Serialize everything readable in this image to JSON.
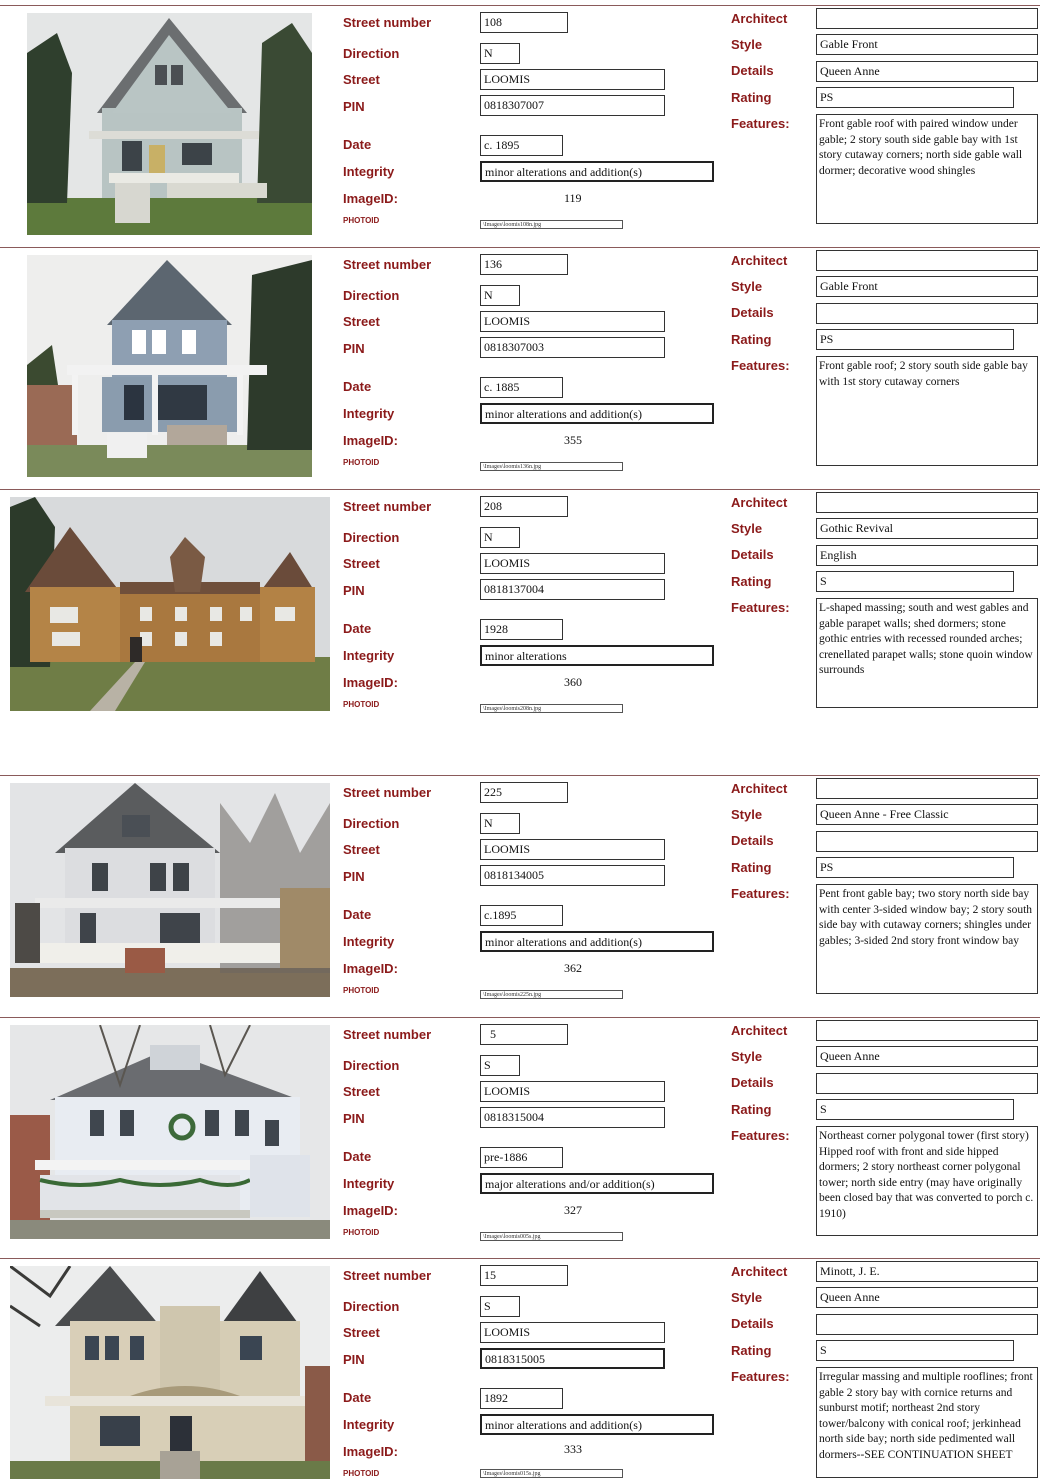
{
  "labels": {
    "street_number": "Street number",
    "direction": "Direction",
    "street": "Street",
    "pin": "PIN",
    "date": "Date",
    "integrity": "Integrity",
    "image_id": "ImageID:",
    "photo_id": "PHOTOID",
    "architect": "Architect",
    "style": "Style",
    "details": "Details",
    "rating": "Rating",
    "features": "Features:"
  },
  "colors": {
    "label": "#8b1a1a",
    "divider": "#8a5a5a"
  },
  "records": [
    {
      "street_number": "108",
      "direction": "N",
      "street": "LOOMIS",
      "pin": "0818307007",
      "date": "c. 1895",
      "integrity": "minor alterations and addition(s)",
      "image_id": "119",
      "photo_id": "\\Images\\loomis108n.jpg",
      "architect": "",
      "style": "Gable Front",
      "details": "Queen Anne",
      "rating": "PS",
      "features": "Front gable roof with paired window under gable; 2 story south side gable bay with 1st story cutaway corners; north side gable wall dormer; decorative wood shingles"
    },
    {
      "street_number": "136",
      "direction": "N",
      "street": "LOOMIS",
      "pin": "0818307003",
      "date": "c. 1885",
      "integrity": "minor alterations and addition(s)",
      "image_id": "355",
      "photo_id": "\\Images\\loomis136n.jpg",
      "architect": "",
      "style": "Gable Front",
      "details": "",
      "rating": "PS",
      "features": "Front gable roof; 2 story south side gable bay with 1st story cutaway corners"
    },
    {
      "street_number": "208",
      "direction": "N",
      "street": "LOOMIS",
      "pin": "0818137004",
      "date": "1928",
      "integrity": "minor alterations",
      "image_id": "360",
      "photo_id": "\\Images\\loomis208n.jpg",
      "architect": "",
      "style": "Gothic Revival",
      "details": "English",
      "rating": "S",
      "features": "L-shaped massing; south and west gables and gable parapet walls; shed dormers; stone gothic entries with recessed rounded arches; crenellated parapet walls; stone quoin window surrounds"
    },
    {
      "street_number": "225",
      "direction": "N",
      "street": "LOOMIS",
      "pin": "0818134005",
      "date": "c.1895",
      "integrity": "minor alterations and addition(s)",
      "image_id": "362",
      "photo_id": "\\Images\\loomis225n.jpg",
      "architect": "",
      "style": "Queen Anne - Free Classic",
      "details": "",
      "rating": "PS",
      "features": "Pent front gable bay; two story north side bay with center 3-sided window bay; 2 story south side bay with cutaway corners; shingles under gables; 3-sided 2nd story front window bay"
    },
    {
      "street_number": "5",
      "direction": "S",
      "street": "LOOMIS",
      "pin": "0818315004",
      "date": "pre-1886",
      "integrity": "major alterations and/or addition(s)",
      "image_id": "327",
      "photo_id": "\\Images\\loomis005s.jpg",
      "architect": "",
      "style": "Queen Anne",
      "details": "",
      "rating": "S",
      "features": "Northeast corner polygonal tower (first story) Hipped roof with front and side hipped dormers; 2 story northeast corner polygonal tower; north side entry (may have originally been closed bay that was converted to porch c. 1910)"
    },
    {
      "street_number": "15",
      "direction": "S",
      "street": "LOOMIS",
      "pin": "0818315005",
      "date": "1892",
      "integrity": "minor alterations and addition(s)",
      "image_id": "333",
      "photo_id": "\\Images\\loomis015s.jpg",
      "architect": "Minott, J. E.",
      "style": "Queen Anne",
      "details": "",
      "rating": "S",
      "features": "Irregular massing and multiple rooflines; front gable 2 story bay with cornice returns and sunburst motif; northeast 2nd story tower/balcony with conical roof; jerkinhead north side bay; north side pedimented wall dormers--SEE CONTINUATION SHEET"
    }
  ]
}
